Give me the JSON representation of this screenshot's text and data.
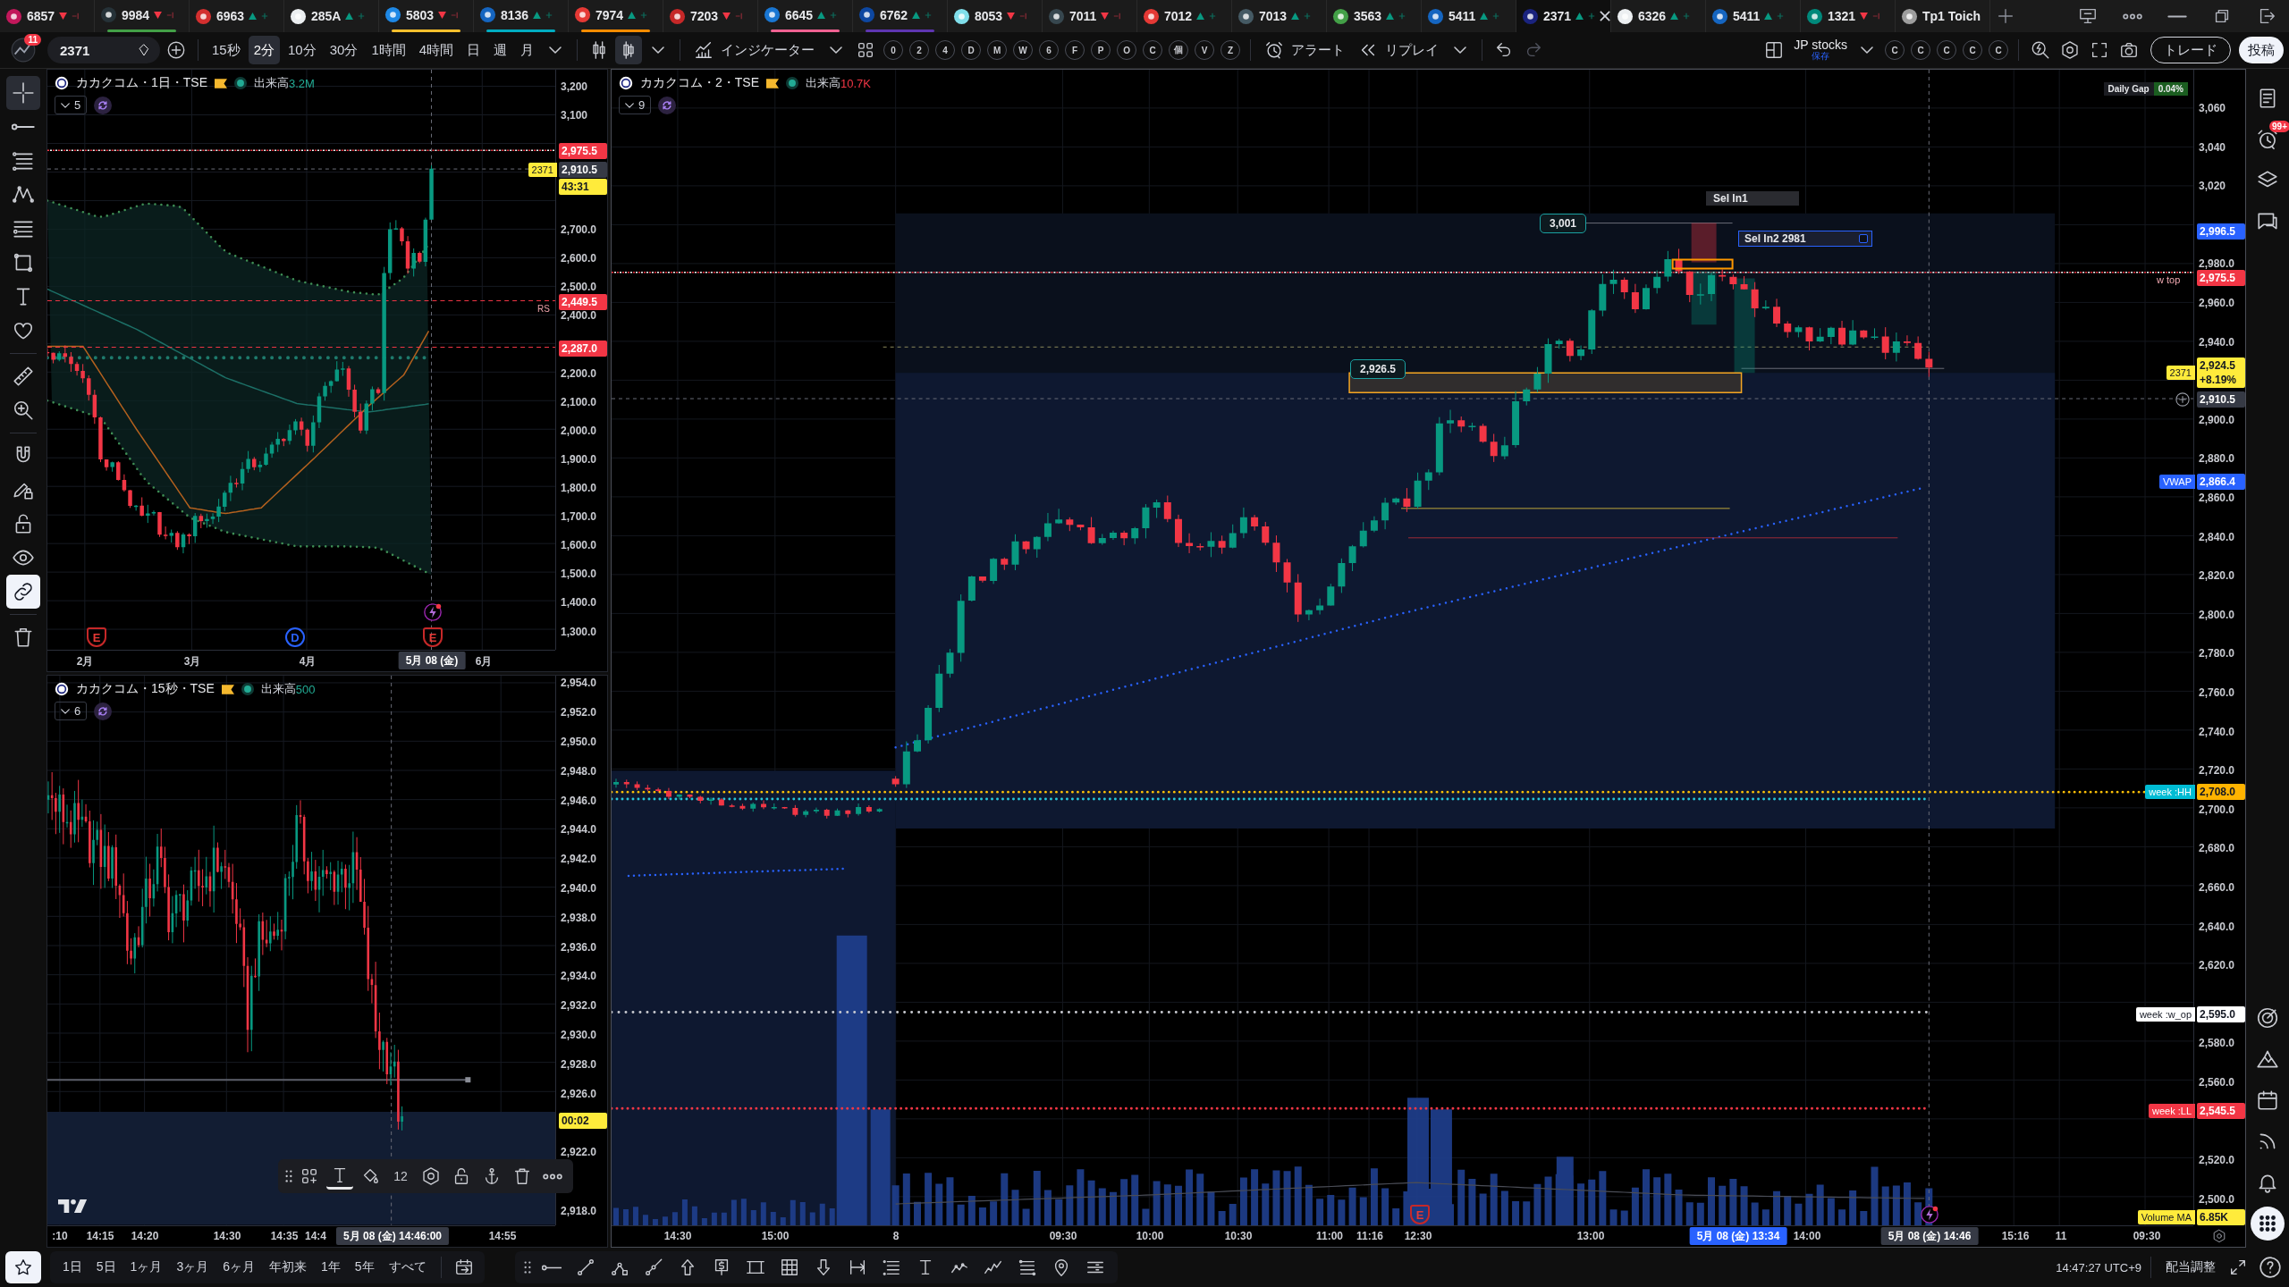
{
  "tabs": [
    {
      "ticker": "6857",
      "rising": false,
      "selected": false
    },
    {
      "ticker": "9984",
      "rising": false,
      "selected": false,
      "color": "#43a047"
    },
    {
      "ticker": "6963",
      "rising": true,
      "selected": false
    },
    {
      "ticker": "285A",
      "rising": true,
      "selected": false
    },
    {
      "ticker": "5803",
      "rising": false,
      "selected": false,
      "color": "#fbc02d"
    },
    {
      "ticker": "8136",
      "rising": true,
      "selected": false,
      "color": "#00acc1"
    },
    {
      "ticker": "7974",
      "rising": true,
      "selected": false,
      "color": "#fb8c00"
    },
    {
      "ticker": "7203",
      "rising": false,
      "selected": false
    },
    {
      "ticker": "6645",
      "rising": true,
      "selected": false,
      "color": "#f06292"
    },
    {
      "ticker": "6762",
      "rising": true,
      "selected": false,
      "color": "#5e35b1"
    },
    {
      "ticker": "8053",
      "rising": false,
      "selected": false
    },
    {
      "ticker": "7011",
      "rising": false,
      "selected": false
    },
    {
      "ticker": "7012",
      "rising": true,
      "selected": false
    },
    {
      "ticker": "7013",
      "rising": true,
      "selected": false
    },
    {
      "ticker": "3563",
      "rising": true,
      "selected": false
    },
    {
      "ticker": "5411",
      "rising": true,
      "selected": false
    },
    {
      "ticker": "2371",
      "rising": true,
      "selected": true
    },
    {
      "ticker": "6326",
      "rising": true,
      "selected": false
    },
    {
      "ticker": "5411",
      "rising": true,
      "selected": false
    },
    {
      "ticker": "1321",
      "rising": false,
      "selected": false
    },
    {
      "ticker": "Tp1 Toich",
      "selected": false
    }
  ],
  "toolbar": {
    "notifications": "11",
    "symbol": "2371",
    "intervals": [
      {
        "label": "15秒",
        "selected": false
      },
      {
        "label": "2分",
        "selected": true
      },
      {
        "label": "10分",
        "selected": false
      },
      {
        "label": "30分",
        "selected": false
      },
      {
        "label": "1時間",
        "selected": false
      },
      {
        "label": "4時間",
        "selected": false
      },
      {
        "label": "日",
        "selected": false
      },
      {
        "label": "週",
        "selected": false
      },
      {
        "label": "月",
        "selected": false
      }
    ],
    "chart_styles": [
      {
        "selected": false
      },
      {
        "selected": true
      }
    ],
    "indicators": "インジケーター",
    "quick_buttons": [
      "0",
      "2",
      "4",
      "D",
      "M",
      "W",
      "6",
      "F",
      "P",
      "O",
      "C",
      "個",
      "V",
      "Z"
    ],
    "alert": "アラート",
    "replay": "リプレイ",
    "undo": {
      "disabled": false
    },
    "redo": {
      "disabled": true
    },
    "layout_name": "JP stocks",
    "layout_status": "保存",
    "compare_buttons": [
      "C",
      "C",
      "C",
      "C",
      "C"
    ],
    "trade": "トレード",
    "publish": "投稿"
  },
  "left_tools": [
    {
      "selected": true
    },
    {
      "selected": false
    },
    {
      "selected": false
    },
    {
      "selected": false
    },
    {
      "selected": false
    },
    {
      "selected": false
    },
    {
      "selected": false
    },
    {
      "selected": false
    },
    {
      "selected": false
    },
    {
      "selected": false
    },
    {
      "selected": false
    },
    {
      "selected": false
    },
    {
      "selected": false
    },
    {
      "selected": false
    },
    {
      "selected": true
    },
    {
      "selected": false
    }
  ],
  "left_charts": [
    {
      "title": "カカクコム・1日・TSE",
      "volume_label": "出来高",
      "volume": "3.2M",
      "volume_rising": true,
      "legend_count": "5",
      "price_ticks": [
        "3,200",
        "3,100",
        "2,700.0",
        "2,600.0",
        "2,500.0",
        "2,400.0",
        "2,200.0",
        "2,100.0",
        "2,000.0",
        "1,900.0",
        "1,800.0",
        "1,700.0",
        "1,600.0",
        "1,500.0",
        "1,400.0",
        "1,300.0"
      ],
      "price_badges": [
        {
          "text": "2,975.5",
          "color": "#f23645"
        },
        {
          "tag": {
            "text": "2371",
            "color": "#ffeb3b"
          },
          "text": "2,910.5",
          "color": "#363a45"
        },
        {
          "text": "43:31",
          "color": "#ffeb3b"
        },
        {
          "text": "2,449.5",
          "color": "#f23645"
        },
        {
          "text": "2,287.0",
          "color": "#f23645"
        }
      ],
      "line_labels": [
        "RS"
      ],
      "time_ticks": [
        "2月",
        "3月",
        "4月",
        "6月"
      ],
      "time_cursor": "5月 08 (金)",
      "markers": [
        {
          "kind": "earnings",
          "label": "E"
        },
        {
          "kind": "dividend",
          "label": "D"
        },
        {
          "kind": "earnings",
          "label": "E"
        },
        {
          "kind": "flash"
        }
      ]
    },
    {
      "title": "カカクコム・15秒・TSE",
      "volume_label": "出来高",
      "volume": "500",
      "volume_rising": true,
      "legend_count": "6",
      "price_ticks": [
        "2,954.0",
        "2,952.0",
        "2,950.0",
        "2,948.0",
        "2,946.0",
        "2,944.0",
        "2,942.0",
        "2,940.0",
        "2,938.0",
        "2,936.0",
        "2,934.0",
        "2,932.0",
        "2,930.0",
        "2,928.0",
        "2,926.0",
        "2,922.0",
        "2,918.0"
      ],
      "price_badges": [
        {
          "text": "00:02",
          "color": "#ffeb3b"
        }
      ],
      "time_ticks": [
        ":10",
        "14:15",
        "14:20",
        "14:30",
        "14:35",
        "14:4",
        "14:55"
      ],
      "time_cursor": "5月 08 (金)  14:46:00"
    }
  ],
  "floating_toolbar": {
    "text_active": true,
    "font_size": "12"
  },
  "main_chart": {
    "title": "カカクコム・2・TSE",
    "volume_label": "出来高",
    "volume": "10.7K",
    "volume_rising": false,
    "legend_count": "9",
    "daily_gap": {
      "label": "Daily Gap",
      "value": "0.04%"
    },
    "annotations": [
      {
        "kind": "chip",
        "text": "Sel In1"
      },
      {
        "kind": "price",
        "text": "3,001"
      },
      {
        "kind": "selected",
        "text": "Sel In2  2981"
      },
      {
        "kind": "price",
        "text": "2,926.5"
      },
      {
        "kind": "note",
        "text": "w top"
      }
    ],
    "price_ticks": [
      "3,060",
      "3,040",
      "3,020",
      "2,980.0",
      "2,960.0",
      "2,940.0",
      "2,900.0",
      "2,880.0",
      "2,860.0",
      "2,840.0",
      "2,820.0",
      "2,800.0",
      "2,780.0",
      "2,760.0",
      "2,740.0",
      "2,720.0",
      "2,700.0",
      "2,680.0",
      "2,660.0",
      "2,640.0",
      "2,620.0",
      "2,580.0",
      "2,560.0",
      "2,520.0",
      "2,500.0"
    ],
    "price_badges": [
      {
        "text": "2,996.5",
        "color": "#2962ff"
      },
      {
        "text": "2,975.5",
        "color": "#f23645"
      },
      {
        "tag": {
          "text": "2371",
          "color": "#ffeb3b"
        },
        "text": "2,924.5",
        "sub": "+8.19%",
        "color": "#ffeb3b"
      },
      {
        "text": "2,910.5",
        "color": "#363a45"
      },
      {
        "tag": {
          "text": "VWAP",
          "color": "#2962ff"
        },
        "text": "2,866.4",
        "color": "#2962ff"
      },
      {
        "tag": {
          "text": "week :HH",
          "color": "#00bcd4"
        },
        "text": "2,708.0",
        "color": "#ffb300"
      },
      {
        "tag": {
          "text": "week :w_op",
          "color": "#ffffff"
        },
        "text": "2,595.0",
        "color": "#ffffff"
      },
      {
        "tag": {
          "text": "week :LL",
          "color": "#f23645"
        },
        "text": "2,545.5",
        "color": "#f23645"
      },
      {
        "tag": {
          "text": "Volume MA",
          "color": "#ffeb3b"
        },
        "text": "6.85K",
        "color": "#ffeb3b"
      }
    ],
    "time_ticks": [
      "14:30",
      "15:00",
      "8",
      "09:30",
      "10:00",
      "10:30",
      "11:00",
      "11:16",
      "12:30",
      "13:00",
      "14:00",
      "15:16",
      "11",
      "09:30"
    ],
    "time_cursors": [
      {
        "text": "5月 08 (金)  13:34",
        "selected": true
      },
      {
        "text": "5月 08 (金)  14:46",
        "selected": false
      }
    ],
    "markers": [
      {
        "kind": "earnings",
        "label": "E"
      },
      {
        "kind": "flash"
      }
    ]
  },
  "sidebar": {
    "alert_badge": "99+",
    "items": [
      {
        "selected": false
      },
      {
        "selected": false
      },
      {
        "selected": false
      },
      {
        "selected": false
      },
      {
        "selected": false
      },
      {
        "selected": false
      },
      {
        "selected": false
      },
      {
        "selected": false
      },
      {
        "selected": false
      },
      {
        "selected": true
      }
    ]
  },
  "bottom_bar": {
    "ranges": [
      "1日",
      "5日",
      "1ヶ月",
      "3ヶ月",
      "6ヶ月",
      "年初来",
      "1年",
      "5年",
      "すべて"
    ],
    "clock": "14:47:27 UTC+9",
    "adjust": "配当調整"
  }
}
